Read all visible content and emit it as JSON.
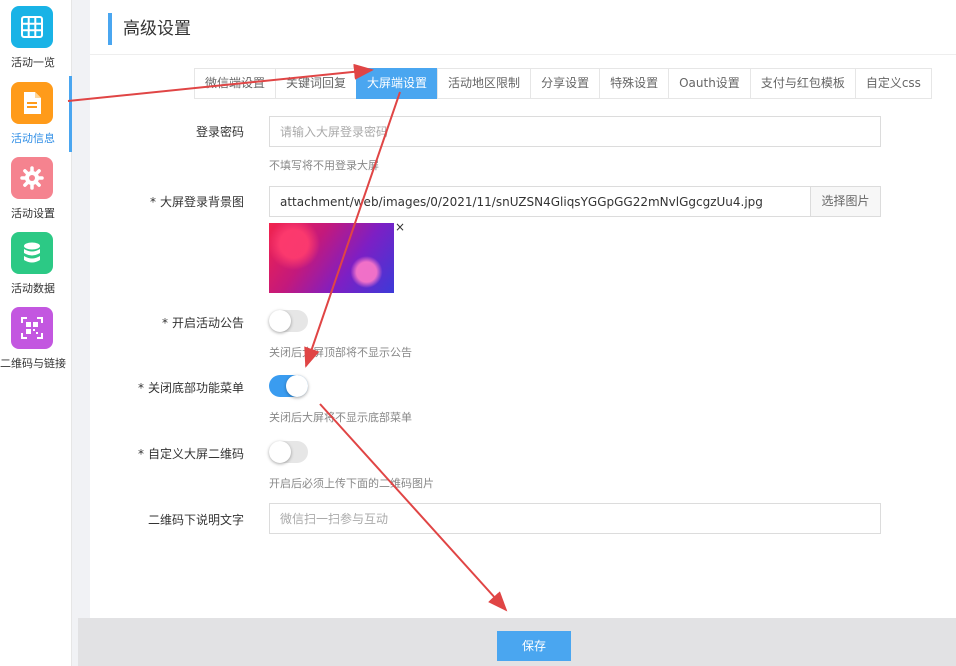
{
  "sidebar": {
    "items": [
      {
        "label": "活动一览",
        "color": "#19b3e6",
        "icon": "grid-icon"
      },
      {
        "label": "活动信息",
        "color": "#ff9b1a",
        "icon": "document-icon"
      },
      {
        "label": "活动设置",
        "color": "#f5838f",
        "icon": "gear-icon"
      },
      {
        "label": "活动数据",
        "color": "#2cc985",
        "icon": "database-icon"
      },
      {
        "label": "二维码与链接",
        "color": "#c357e0",
        "icon": "qrcode-icon"
      }
    ],
    "active_index": 1
  },
  "page": {
    "title": "高级设置"
  },
  "tabs": [
    {
      "label": "微信端设置"
    },
    {
      "label": "关键词回复"
    },
    {
      "label": "大屏端设置",
      "active": true
    },
    {
      "label": "活动地区限制"
    },
    {
      "label": "分享设置"
    },
    {
      "label": "特殊设置"
    },
    {
      "label": "Oauth设置"
    },
    {
      "label": "支付与红包模板"
    },
    {
      "label": "自定义css"
    }
  ],
  "form": {
    "login_password": {
      "label": "登录密码",
      "placeholder": "请输入大屏登录密码",
      "help": "不填写将不用登录大屏"
    },
    "background": {
      "required_mark": "*",
      "label": "大屏登录背景图",
      "value": "attachment/web/images/0/2021/11/snUZSN4GliqsYGGpGG22mNvlGgcgzUu4.jpg",
      "button": "选择图片",
      "remove": "×"
    },
    "notice": {
      "required_mark": "*",
      "label": "开启活动公告",
      "enabled": false,
      "help": "关闭后大屏顶部将不显示公告"
    },
    "bottom_menu": {
      "required_mark": "*",
      "label": "关闭底部功能菜单",
      "enabled": true,
      "help": "关闭后大屏将不显示底部菜单"
    },
    "custom_qrcode": {
      "required_mark": "*",
      "label": "自定义大屏二维码",
      "enabled": false,
      "help": "开启后必须上传下面的二维码图片"
    },
    "qrcode_caption": {
      "label": "二维码下说明文字",
      "placeholder": "微信扫一扫参与互动"
    }
  },
  "footer": {
    "save_label": "保存"
  },
  "colors": {
    "accent": "#4aa6f0",
    "arrow": "#e04545"
  }
}
